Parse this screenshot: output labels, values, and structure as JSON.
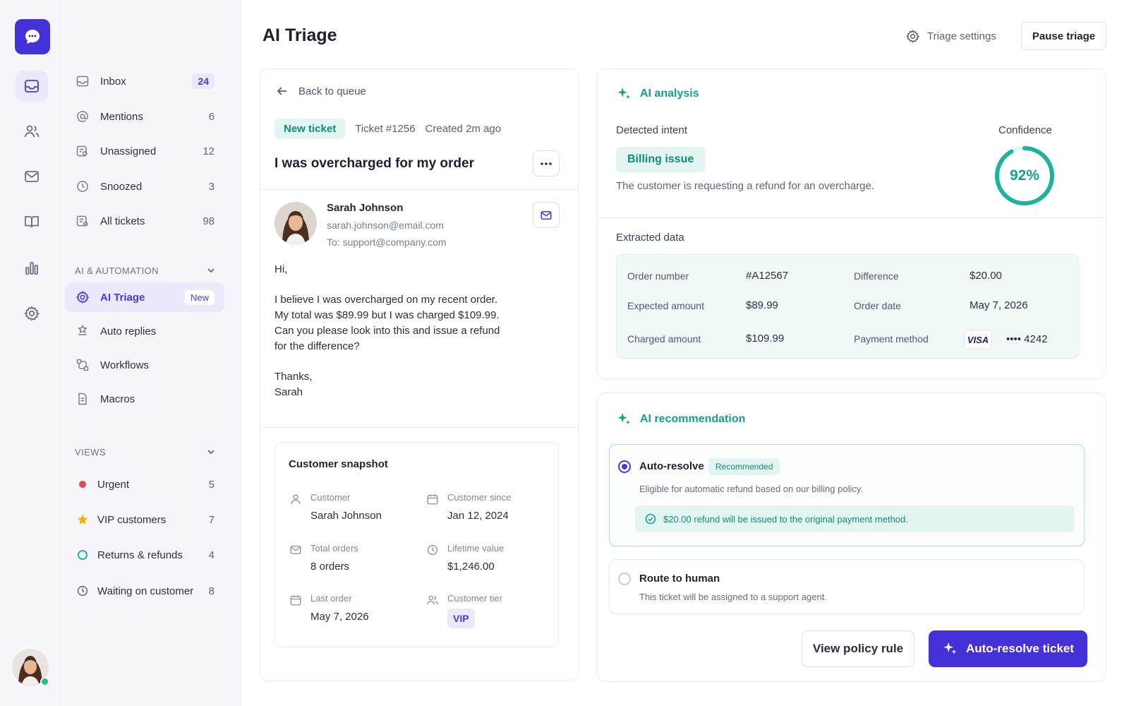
{
  "header": {
    "title": "AI Triage",
    "settings_label": "Triage settings",
    "pause_label": "Pause triage"
  },
  "nav": {
    "items": [
      {
        "label": "Inbox",
        "count": "24",
        "icon": "inbox-icon"
      },
      {
        "label": "Mentions",
        "count": "6",
        "icon": "at-icon"
      },
      {
        "label": "Unassigned",
        "count": "12",
        "icon": "unassigned-icon"
      },
      {
        "label": "Snoozed",
        "count": "3",
        "icon": "clock-icon"
      },
      {
        "label": "All tickets",
        "count": "98",
        "icon": "tickets-icon"
      }
    ],
    "ai_section": "AI & AUTOMATION",
    "ai_items": [
      {
        "label": "AI Triage",
        "badge": "New",
        "icon": "triage-gear-icon"
      },
      {
        "label": "Auto replies",
        "icon": "auto-reply-icon"
      },
      {
        "label": "Workflows",
        "icon": "workflow-icon"
      },
      {
        "label": "Macros",
        "icon": "macro-icon"
      }
    ],
    "views_section": "VIEWS",
    "views": [
      {
        "label": "Urgent",
        "count": "5",
        "marker": "red-dot"
      },
      {
        "label": "VIP customers",
        "count": "7",
        "marker": "star"
      },
      {
        "label": "Returns & refunds",
        "count": "4",
        "marker": "teal-ring"
      },
      {
        "label": "Waiting on customer",
        "count": "8",
        "marker": "clock"
      }
    ]
  },
  "ticket": {
    "back_label": "Back to queue",
    "status_tag": "New ticket",
    "ticket_number": "Ticket #1256",
    "created": "Created 2m ago",
    "subject": "I was overcharged for my order",
    "sender_name": "Sarah Johnson",
    "sender_email": "sarah.johnson@email.com",
    "to_line": "To: support@company.com",
    "body": [
      "Hi,",
      "I believe I was overcharged on my recent order.",
      "My total was $89.99 but I was charged $109.99.",
      "Can you please look into this and issue a refund",
      "for the difference?",
      "Thanks,",
      "Sarah"
    ]
  },
  "snapshot": {
    "title": "Customer snapshot",
    "customer_label": "Customer",
    "customer_value": "Sarah Johnson",
    "since_label": "Customer since",
    "since_value": "Jan 12, 2024",
    "orders_label": "Total orders",
    "orders_value": "8 orders",
    "ltv_label": "Lifetime value",
    "ltv_value": "$1,246.00",
    "last_label": "Last order",
    "last_value": "May 7, 2026",
    "tier_label": "Customer tier",
    "tier_value": "VIP"
  },
  "analysis": {
    "title": "AI analysis",
    "intent_label": "Detected intent",
    "intent_value": "Billing issue",
    "intent_desc": "The customer is requesting a refund for an overcharge.",
    "confidence_label": "Confidence",
    "confidence_text": "92%",
    "confidence_value": 0.92,
    "extracted_label": "Extracted data",
    "fields": {
      "order_number_label": "Order number",
      "order_number": "#A12567",
      "difference_label": "Difference",
      "difference": "$20.00",
      "expected_label": "Expected amount",
      "expected": "$89.99",
      "order_date_label": "Order date",
      "order_date": "May 7, 2026",
      "charged_label": "Charged amount",
      "charged": "$109.99",
      "payment_label": "Payment method",
      "card_brand": "VISA",
      "card_last4": "•••• 4242"
    }
  },
  "recommendation": {
    "title": "AI recommendation",
    "auto_title": "Auto-resolve",
    "auto_tag": "Recommended",
    "auto_desc": "Eligible for automatic refund based on our billing policy.",
    "refund_note": "$20.00 refund will be issued to the original payment method.",
    "human_title": "Route to human",
    "human_desc": "This ticket will be assigned to a support agent.",
    "policy_button": "View policy rule",
    "resolve_button": "Auto-resolve ticket"
  },
  "colors": {
    "brand": "#4531d8",
    "accent_teal": "#15a08a",
    "urgent": "#e5484d",
    "star": "#f5b301"
  }
}
